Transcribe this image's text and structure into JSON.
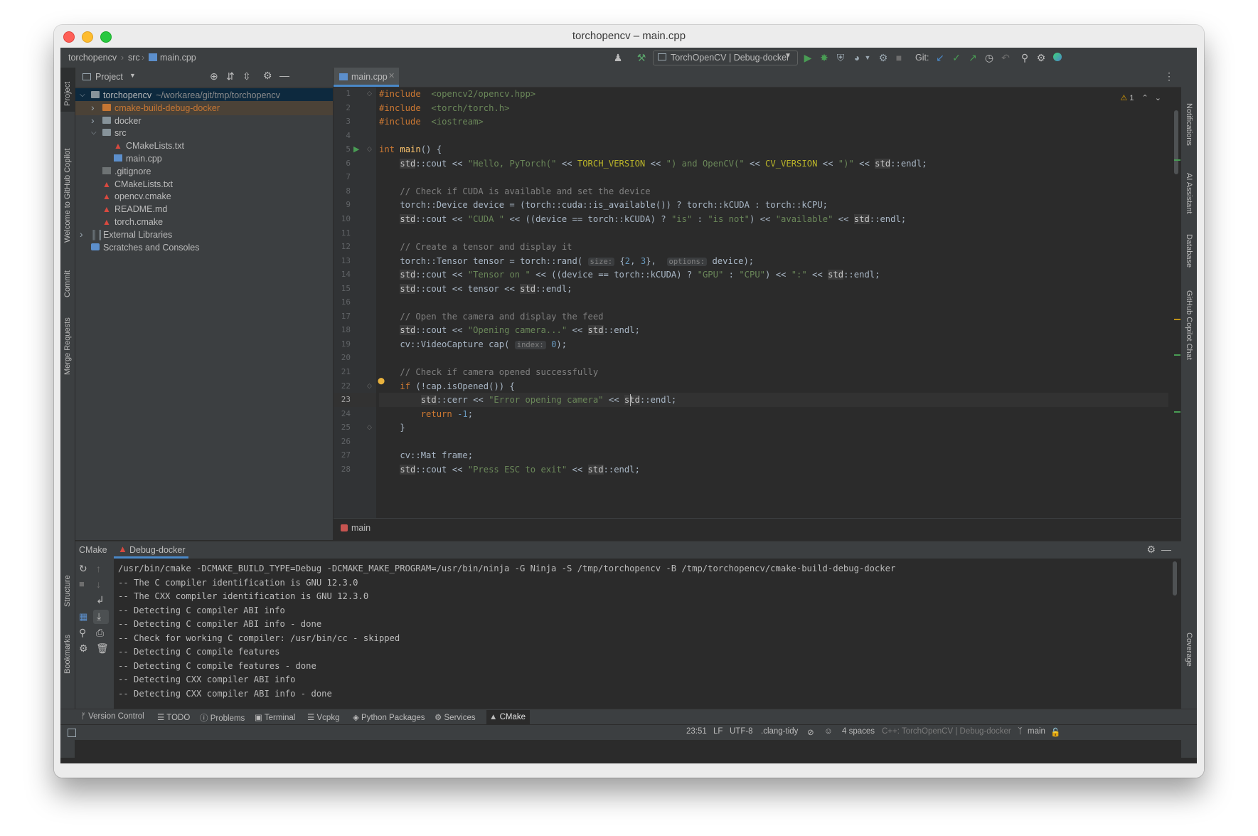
{
  "window": {
    "title": "torchopencv – main.cpp"
  },
  "navbar": {
    "breadcrumb": [
      "torchopencv",
      "src",
      "main.cpp"
    ],
    "run_config": "TorchOpenCV | Debug-docker",
    "git_label": "Git:"
  },
  "left_strip": [
    "Project",
    "Welcome to GitHub Copilot",
    "Commit",
    "Merge Requests",
    "Structure",
    "Bookmarks"
  ],
  "right_strip": [
    "Notifications",
    "AI Assistant",
    "Database",
    "GitHub Copilot Chat",
    "Coverage"
  ],
  "project": {
    "header": "Project",
    "tree": [
      {
        "label": "torchopencv",
        "extra": "~/workarea/git/tmp/torchopencv",
        "depth": 0,
        "arrow": "open",
        "icon": "folder-icon"
      },
      {
        "label": "cmake-build-debug-docker",
        "depth": 1,
        "arrow": "closed",
        "icon": "folder-orange-icon"
      },
      {
        "label": "docker",
        "depth": 1,
        "arrow": "closed",
        "icon": "folder-icon"
      },
      {
        "label": "src",
        "depth": 1,
        "arrow": "open",
        "icon": "folder-icon"
      },
      {
        "label": "CMakeLists.txt",
        "depth": 2,
        "arrow": "",
        "icon": "cmake-icon"
      },
      {
        "label": "main.cpp",
        "depth": 2,
        "arrow": "",
        "icon": "cpp-file-icon"
      },
      {
        "label": ".gitignore",
        "depth": 1,
        "arrow": "",
        "icon": "gitignore-icon"
      },
      {
        "label": "CMakeLists.txt",
        "depth": 1,
        "arrow": "",
        "icon": "cmake-icon"
      },
      {
        "label": "opencv.cmake",
        "depth": 1,
        "arrow": "",
        "icon": "cmake-icon"
      },
      {
        "label": "README.md",
        "depth": 1,
        "arrow": "",
        "icon": "markdown-icon"
      },
      {
        "label": "torch.cmake",
        "depth": 1,
        "arrow": "",
        "icon": "cmake-icon"
      },
      {
        "label": "External Libraries",
        "depth": 0,
        "arrow": "closed",
        "icon": "library-icon"
      },
      {
        "label": "Scratches and Consoles",
        "depth": 0,
        "arrow": "",
        "icon": "scratches-icon"
      }
    ]
  },
  "editor": {
    "tab": "main.cpp",
    "warning_count": "1",
    "current_line": 23,
    "breadcrumb": "main",
    "lines": [
      [
        [
          "kw",
          "#include"
        ],
        [
          "",
          "  "
        ],
        [
          "st",
          "<opencv2/opencv.hpp>"
        ]
      ],
      [
        [
          "kw",
          "#include"
        ],
        [
          "",
          "  "
        ],
        [
          "st",
          "<torch/torch.h>"
        ]
      ],
      [
        [
          "kw",
          "#include"
        ],
        [
          "",
          "  "
        ],
        [
          "st",
          "<iostream>"
        ]
      ],
      [],
      [
        [
          "kw",
          "int"
        ],
        [
          "",
          " "
        ],
        [
          "fn",
          "main"
        ],
        [
          "",
          "() {"
        ]
      ],
      [
        [
          "",
          "    "
        ],
        [
          "stdh",
          "std"
        ],
        [
          "",
          "::cout << "
        ],
        [
          "st",
          "\"Hello, PyTorch(\""
        ],
        [
          "",
          " << "
        ],
        [
          "mac",
          "TORCH_VERSION"
        ],
        [
          "",
          " << "
        ],
        [
          "st",
          "\") and OpenCV(\""
        ],
        [
          "",
          " << "
        ],
        [
          "mac",
          "CV_VERSION"
        ],
        [
          "",
          " << "
        ],
        [
          "st",
          "\")\""
        ],
        [
          "",
          " << "
        ],
        [
          "stdh",
          "std"
        ],
        [
          "",
          "::endl;"
        ]
      ],
      [],
      [
        [
          "",
          "    "
        ],
        [
          "cm",
          "// Check if CUDA is available and set the device"
        ]
      ],
      [
        [
          "",
          "    torch::Device device = (torch::cuda::is_available()) ? torch::kCUDA : torch::kCPU;"
        ]
      ],
      [
        [
          "",
          "    "
        ],
        [
          "stdh",
          "std"
        ],
        [
          "",
          "::cout << "
        ],
        [
          "st",
          "\"CUDA \""
        ],
        [
          "",
          " << ((device == torch::kCUDA) ? "
        ],
        [
          "st",
          "\"is\""
        ],
        [
          "",
          " : "
        ],
        [
          "st",
          "\"is not\""
        ],
        [
          "",
          ") << "
        ],
        [
          "st",
          "\"available\""
        ],
        [
          "",
          " << "
        ],
        [
          "stdh",
          "std"
        ],
        [
          "",
          "::endl;"
        ]
      ],
      [],
      [
        [
          "",
          "    "
        ],
        [
          "cm",
          "// Create a tensor and display it"
        ]
      ],
      [
        [
          "",
          "    torch::Tensor tensor = torch::rand( "
        ],
        [
          "hint",
          "size:"
        ],
        [
          "",
          " {"
        ],
        [
          "nm",
          "2"
        ],
        [
          "",
          ", "
        ],
        [
          "nm",
          "3"
        ],
        [
          "",
          "},  "
        ],
        [
          "hint",
          "options:"
        ],
        [
          "",
          " device);"
        ]
      ],
      [
        [
          "",
          "    "
        ],
        [
          "stdh",
          "std"
        ],
        [
          "",
          "::cout << "
        ],
        [
          "st",
          "\"Tensor on \""
        ],
        [
          "",
          " << ((device == torch::kCUDA) ? "
        ],
        [
          "st",
          "\"GPU\""
        ],
        [
          "",
          " : "
        ],
        [
          "st",
          "\"CPU\""
        ],
        [
          "",
          ") << "
        ],
        [
          "st",
          "\":\""
        ],
        [
          "",
          " << "
        ],
        [
          "stdh",
          "std"
        ],
        [
          "",
          "::endl;"
        ]
      ],
      [
        [
          "",
          "    "
        ],
        [
          "stdh",
          "std"
        ],
        [
          "",
          "::cout << tensor << "
        ],
        [
          "stdh",
          "std"
        ],
        [
          "",
          "::endl;"
        ]
      ],
      [],
      [
        [
          "",
          "    "
        ],
        [
          "cm",
          "// Open the camera and display the feed"
        ]
      ],
      [
        [
          "",
          "    "
        ],
        [
          "stdh",
          "std"
        ],
        [
          "",
          "::cout << "
        ],
        [
          "st",
          "\"Opening camera...\""
        ],
        [
          "",
          " << "
        ],
        [
          "stdh",
          "std"
        ],
        [
          "",
          "::endl;"
        ]
      ],
      [
        [
          "",
          "    cv::VideoCapture cap( "
        ],
        [
          "hint",
          "index:"
        ],
        [
          "",
          " "
        ],
        [
          "nm",
          "0"
        ],
        [
          "",
          ");"
        ]
      ],
      [],
      [
        [
          "",
          "    "
        ],
        [
          "cm",
          "// Check if camera opened successfully"
        ]
      ],
      [
        [
          "",
          "    "
        ],
        [
          "kw",
          "if"
        ],
        [
          "",
          " (!cap.isOpened()) {"
        ]
      ],
      [
        [
          "",
          "        "
        ],
        [
          "stdh",
          "std"
        ],
        [
          "",
          "::cerr << "
        ],
        [
          "st",
          "\"Error opening camera\""
        ],
        [
          "",
          " << "
        ],
        [
          "stdh",
          "std"
        ],
        [
          "",
          "::endl;"
        ]
      ],
      [
        [
          "",
          "        "
        ],
        [
          "kw",
          "return"
        ],
        [
          "",
          " "
        ],
        [
          "nm",
          "-1"
        ],
        [
          "",
          ";"
        ]
      ],
      [
        [
          "",
          "    }"
        ]
      ],
      [],
      [
        [
          "",
          "    cv::Mat frame;"
        ]
      ],
      [
        [
          "",
          "    "
        ],
        [
          "stdh",
          "std"
        ],
        [
          "",
          "::cout << "
        ],
        [
          "st",
          "\"Press ESC to exit\""
        ],
        [
          "",
          " << "
        ],
        [
          "stdh",
          "std"
        ],
        [
          "",
          "::endl;"
        ]
      ]
    ]
  },
  "cmake_panel": {
    "tabs": [
      "CMake",
      "Debug-docker"
    ],
    "output": [
      "/usr/bin/cmake -DCMAKE_BUILD_TYPE=Debug -DCMAKE_MAKE_PROGRAM=/usr/bin/ninja -G Ninja -S /tmp/torchopencv -B /tmp/torchopencv/cmake-build-debug-docker",
      "-- The C compiler identification is GNU 12.3.0",
      "-- The CXX compiler identification is GNU 12.3.0",
      "-- Detecting C compiler ABI info",
      "-- Detecting C compiler ABI info - done",
      "-- Check for working C compiler: /usr/bin/cc - skipped",
      "-- Detecting C compile features",
      "-- Detecting C compile features - done",
      "-- Detecting CXX compiler ABI info",
      "-- Detecting CXX compiler ABI info - done"
    ]
  },
  "tool_windows": [
    "Version Control",
    "TODO",
    "Problems",
    "Terminal",
    "Vcpkg",
    "Python Packages",
    "Services",
    "CMake"
  ],
  "status": {
    "position": "23:51",
    "line_sep": "LF",
    "encoding": "UTF-8",
    "linter": ".clang-tidy",
    "indent": "4 spaces",
    "context": "C++: TorchOpenCV | Debug-docker",
    "branch": "main"
  },
  "colors": {
    "accent": "#4a88c7",
    "keyword": "#cc7832",
    "string": "#6a8759",
    "macro": "#bbb529",
    "run_green": "#499c54"
  }
}
